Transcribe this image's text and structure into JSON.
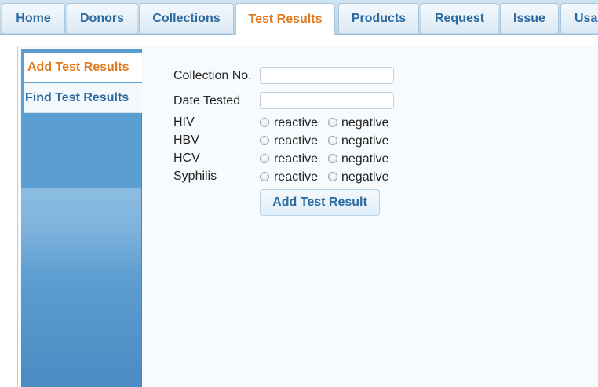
{
  "tabs": [
    "Home",
    "Donors",
    "Collections",
    "Test Results",
    "Products",
    "Request",
    "Issue",
    "Usa"
  ],
  "active_tab": "Test Results",
  "sidebar": {
    "items": [
      {
        "label": "Add Test Results",
        "active": true
      },
      {
        "label": "Find Test Results",
        "active": false
      }
    ]
  },
  "form": {
    "collection_no_label": "Collection No.",
    "collection_no_value": "",
    "date_tested_label": "Date Tested",
    "date_tested_value": "",
    "tests": [
      {
        "name": "HIV",
        "options": [
          "reactive",
          "negative"
        ]
      },
      {
        "name": "HBV",
        "options": [
          "reactive",
          "negative"
        ]
      },
      {
        "name": "HCV",
        "options": [
          "reactive",
          "negative"
        ]
      },
      {
        "name": "Syphilis",
        "options": [
          "reactive",
          "negative"
        ]
      }
    ],
    "submit_label": "Add Test Result"
  },
  "colors": {
    "accent_orange": "#e07a1f",
    "link_blue": "#2c6aa0",
    "sidebar_blue": "#5b9ed2"
  }
}
